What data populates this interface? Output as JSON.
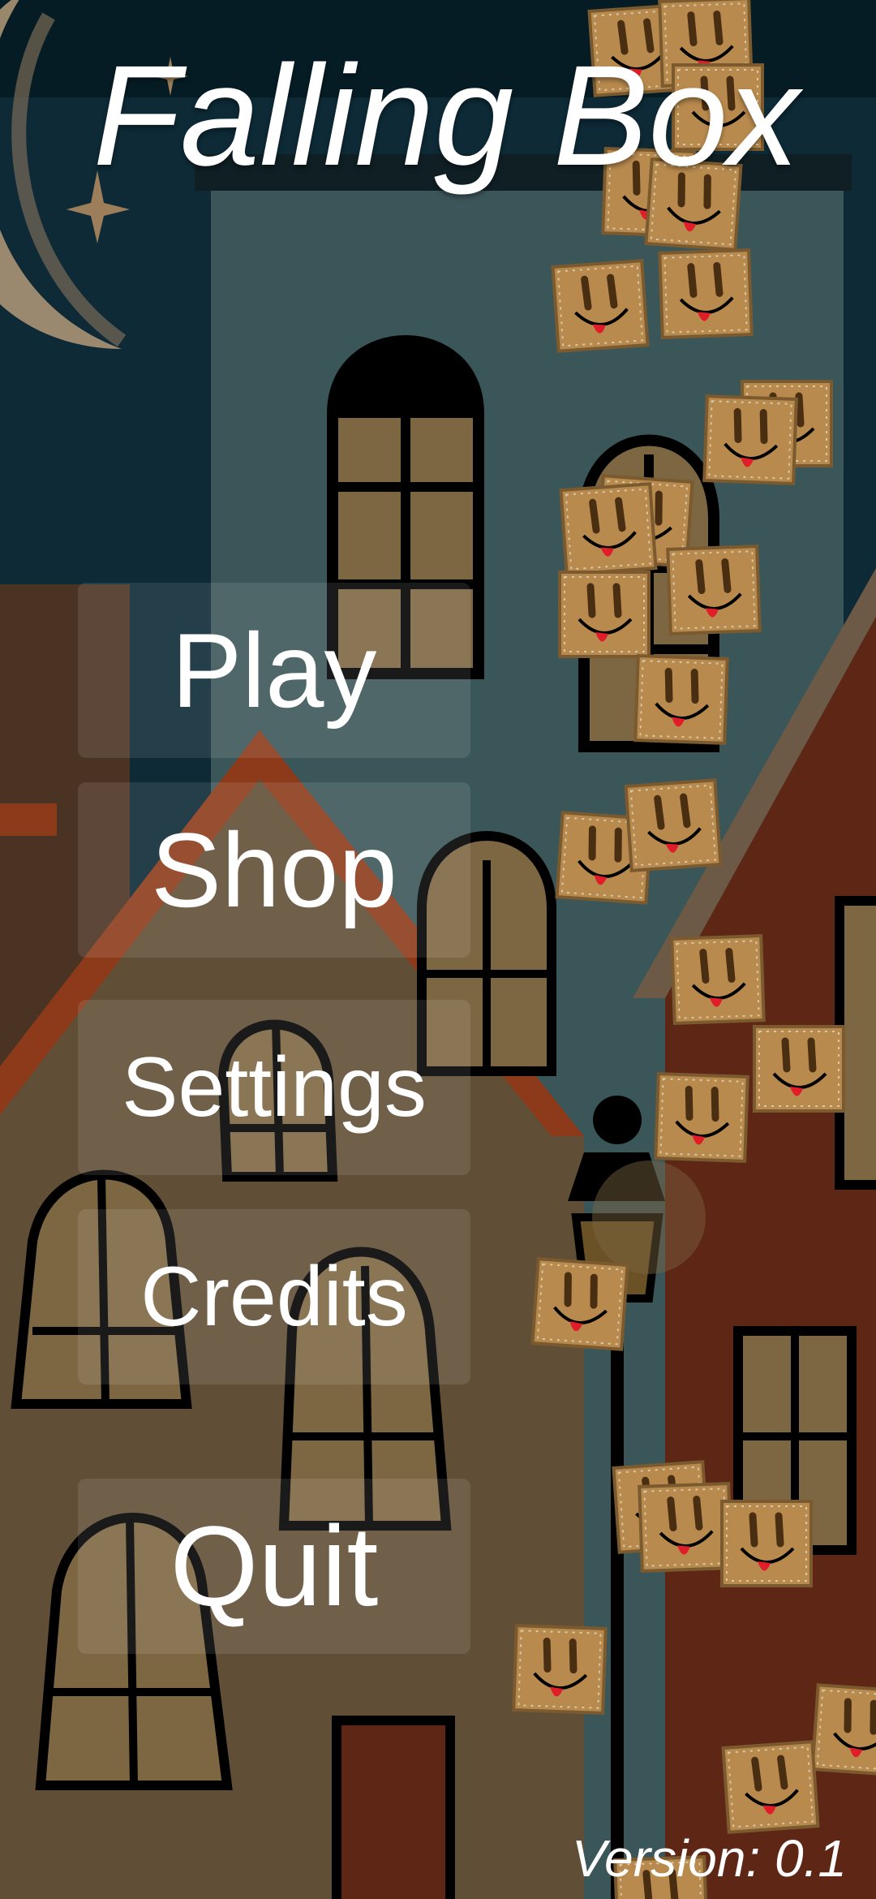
{
  "game": {
    "title": "Falling Box",
    "version": "Version: 0.1"
  },
  "menu": {
    "items": [
      {
        "label": "Play"
      },
      {
        "label": "Shop"
      },
      {
        "label": "Settings"
      },
      {
        "label": "Credits"
      },
      {
        "label": "Quit"
      }
    ]
  },
  "colors": {
    "sky": "#0d2a36",
    "tower": "#3b5659",
    "brick_house": "#5e2614",
    "roof": "#8c3a1a",
    "house": "#604f36",
    "window_glass": "#7d6642",
    "crate": "#b88a4e",
    "text": "#ffffff"
  }
}
